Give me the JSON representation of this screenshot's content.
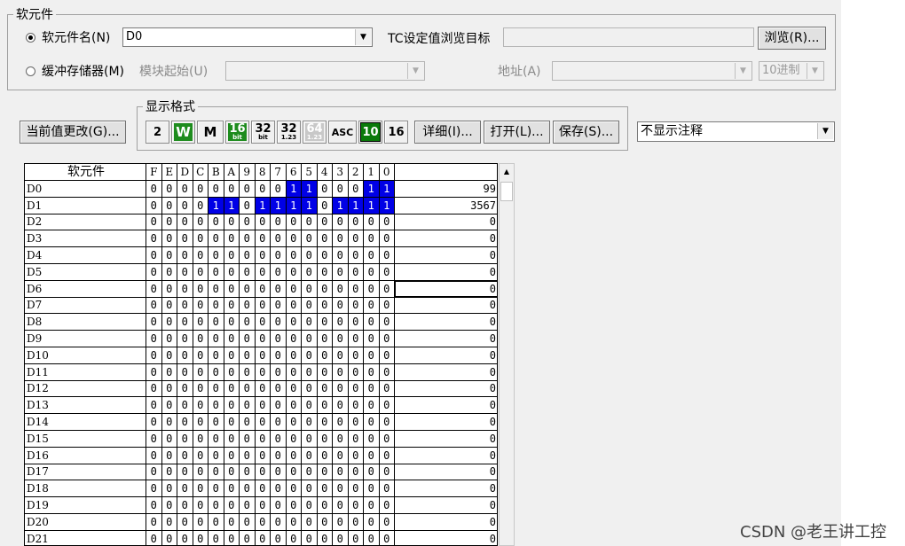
{
  "device_group": {
    "legend": "软元件",
    "device_name_radio": "软元件名(N)",
    "device_name_value": "D0",
    "tc_label": "TC设定值浏览目标",
    "browse_button": "浏览(R)...",
    "buffer_radio": "缓冲存储器(M)",
    "module_start_label": "模块起始(U)",
    "address_label": "地址(A)",
    "radix_value": "10进制"
  },
  "change_current_button": "当前值更改(G)...",
  "format_group": {
    "legend": "显示格式",
    "buttons": [
      {
        "top": "2",
        "bottom": ""
      },
      {
        "top": "W",
        "bottom": ""
      },
      {
        "top": "M",
        "bottom": ""
      },
      {
        "top": "16",
        "bottom": "bit"
      },
      {
        "top": "32",
        "bottom": "bit"
      },
      {
        "top": "32",
        "bottom": "1.23"
      },
      {
        "top": "64",
        "bottom": "1.23"
      },
      {
        "top": "ASC",
        "bottom": ""
      },
      {
        "top": "10",
        "bottom": ""
      },
      {
        "top": "16",
        "bottom": ""
      }
    ]
  },
  "detail_button": "详细(I)...",
  "open_button": "打开(L)...",
  "save_button": "保存(S)...",
  "comment_select": "不显示注释",
  "table": {
    "name_header": "软元件",
    "bit_headers": [
      "F",
      "E",
      "D",
      "C",
      "B",
      "A",
      "9",
      "8",
      "7",
      "6",
      "5",
      "4",
      "3",
      "2",
      "1",
      "0"
    ],
    "rows": [
      {
        "name": "D0",
        "value": "99",
        "bits": "0000000001100011"
      },
      {
        "name": "D1",
        "value": "3567",
        "bits": "0000110111101111"
      },
      {
        "name": "D2",
        "value": "0",
        "bits": "0000000000000000"
      },
      {
        "name": "D3",
        "value": "0",
        "bits": "0000000000000000"
      },
      {
        "name": "D4",
        "value": "0",
        "bits": "0000000000000000"
      },
      {
        "name": "D5",
        "value": "0",
        "bits": "0000000000000000"
      },
      {
        "name": "D6",
        "value": "0",
        "bits": "0000000000000000"
      },
      {
        "name": "D7",
        "value": "0",
        "bits": "0000000000000000"
      },
      {
        "name": "D8",
        "value": "0",
        "bits": "0000000000000000"
      },
      {
        "name": "D9",
        "value": "0",
        "bits": "0000000000000000"
      },
      {
        "name": "D10",
        "value": "0",
        "bits": "0000000000000000"
      },
      {
        "name": "D11",
        "value": "0",
        "bits": "0000000000000000"
      },
      {
        "name": "D12",
        "value": "0",
        "bits": "0000000000000000"
      },
      {
        "name": "D13",
        "value": "0",
        "bits": "0000000000000000"
      },
      {
        "name": "D14",
        "value": "0",
        "bits": "0000000000000000"
      },
      {
        "name": "D15",
        "value": "0",
        "bits": "0000000000000000"
      },
      {
        "name": "D16",
        "value": "0",
        "bits": "0000000000000000"
      },
      {
        "name": "D17",
        "value": "0",
        "bits": "0000000000000000"
      },
      {
        "name": "D18",
        "value": "0",
        "bits": "0000000000000000"
      },
      {
        "name": "D19",
        "value": "0",
        "bits": "0000000000000000"
      },
      {
        "name": "D20",
        "value": "0",
        "bits": "0000000000000000"
      },
      {
        "name": "D21",
        "value": "0",
        "bits": "0000000000000000"
      }
    ],
    "highlight_color": "#0000e6"
  },
  "watermark": "CSDN @老王讲工控"
}
